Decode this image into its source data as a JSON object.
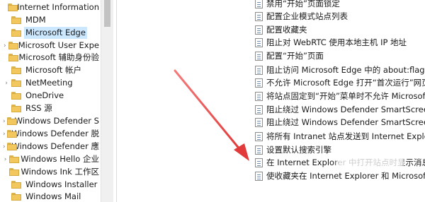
{
  "tree": {
    "items": [
      {
        "label": "Internet Information",
        "expander": "",
        "selected": false
      },
      {
        "label": "MDM",
        "expander": "",
        "selected": false
      },
      {
        "label": "Microsoft Edge",
        "expander": "",
        "selected": true
      },
      {
        "label": "Microsoft User Expe",
        "expander": "›",
        "selected": false
      },
      {
        "label": "Microsoft 辅助身份验",
        "expander": "",
        "selected": false
      },
      {
        "label": "Microsoft 帐户",
        "expander": "",
        "selected": false
      },
      {
        "label": "NetMeeting",
        "expander": "›",
        "selected": false
      },
      {
        "label": "OneDrive",
        "expander": "",
        "selected": false
      },
      {
        "label": "RSS 源",
        "expander": "",
        "selected": false
      },
      {
        "label": "Windows Defender S",
        "expander": "›",
        "selected": false
      },
      {
        "label": "Windows Defender 脱",
        "expander": "›",
        "selected": false
      },
      {
        "label": "Windows Defender 應",
        "expander": "›",
        "selected": false
      },
      {
        "label": "Windows Hello 企业",
        "expander": "›",
        "selected": false
      },
      {
        "label": "Windows Ink 工作区",
        "expander": "",
        "selected": false
      },
      {
        "label": "Windows Installer",
        "expander": "",
        "selected": false
      },
      {
        "label": "Windows Mail",
        "expander": "",
        "selected": false
      }
    ]
  },
  "settings": {
    "rows": [
      {
        "label": "禁用“开始”页面锁定"
      },
      {
        "label": "配置企业模式站点列表"
      },
      {
        "label": "配置收藏夹"
      },
      {
        "label": "阻止对 WebRTC 使用本地主机 IP 地址"
      },
      {
        "label": "配置“开始”页面"
      },
      {
        "label": "阻止访问 Microsoft Edge 中的 about:flags 页"
      },
      {
        "label": "不允许 Microsoft Edge 打开“首次运行”网页"
      },
      {
        "label": "将站点固定到“开始”菜单时不允许 Microsoft Ed"
      },
      {
        "label": "阻止绕过 Windows Defender SmartScreen 站"
      },
      {
        "label": "阻止绕过 Windows Defender SmartScreen 文"
      },
      {
        "label": "将所有 Intranet 站点发送到 Internet Explorer"
      },
      {
        "label": "设置默认搜索引擎"
      },
      {
        "label": "在 Internet Explorer 中打开站点时显示消息"
      },
      {
        "label": "使收藏夹在 Internet Explorer 和 Microsoft Ed"
      }
    ]
  },
  "colors": {
    "selection": "#cce8ff",
    "arrow": "#e23a3a",
    "folder": "#f1c75e"
  }
}
